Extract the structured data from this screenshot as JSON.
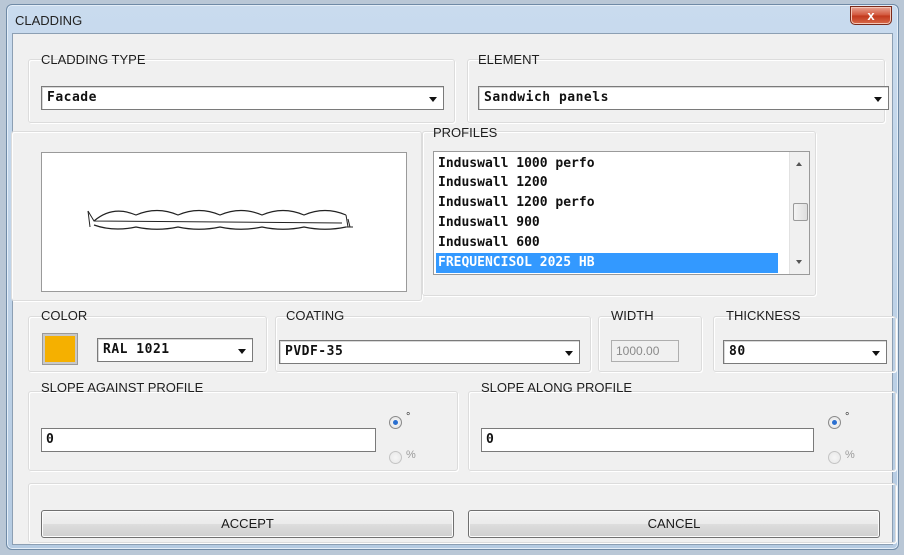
{
  "window": {
    "title": "CLADDING",
    "close_glyph": "x"
  },
  "cladding_type": {
    "label": "CLADDING TYPE",
    "value": "Facade"
  },
  "element": {
    "label": "ELEMENT",
    "value": "Sandwich panels"
  },
  "profiles": {
    "label": "PROFILES",
    "items": [
      "Induswall 1000 perfo",
      "Induswall 1200",
      "Induswall 1200 perfo",
      "Induswall 900",
      "Induswall 600",
      "FREQUENCISOL 2025 HB"
    ],
    "selected": "FREQUENCISOL 2025 HB"
  },
  "color": {
    "label": "COLOR",
    "value": "RAL 1021",
    "swatch": "#f5b000"
  },
  "coating": {
    "label": "COATING",
    "value": "PVDF-35"
  },
  "width": {
    "label": "WIDTH",
    "value": "1000.00"
  },
  "thickness": {
    "label": "THICKNESS",
    "value": "80"
  },
  "slope_against": {
    "label": "SLOPE AGAINST PROFILE",
    "value": "0",
    "unit_degree": "°",
    "unit_percent": "%",
    "selected_unit": "degree"
  },
  "slope_along": {
    "label": "SLOPE ALONG PROFILE",
    "value": "0",
    "unit_degree": "°",
    "unit_percent": "%",
    "selected_unit": "degree"
  },
  "buttons": {
    "accept": "ACCEPT",
    "cancel": "CANCEL"
  },
  "colors": {
    "list_selection": "#3399ff",
    "close_button": "#c2381c"
  }
}
